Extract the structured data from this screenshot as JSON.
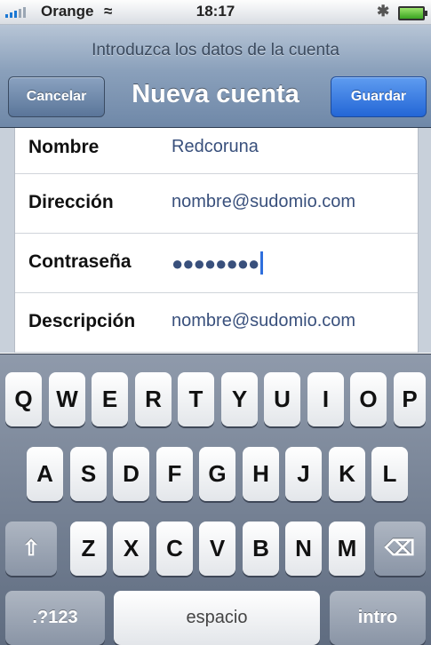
{
  "status_bar": {
    "carrier": "Orange",
    "time": "18:17",
    "wifi_icon": "≈",
    "bluetooth_icon": "✱"
  },
  "nav": {
    "prompt": "Introduzca los datos de la cuenta",
    "title": "Nueva cuenta",
    "cancel_label": "Cancelar",
    "save_label": "Guardar"
  },
  "form": {
    "rows": [
      {
        "label": "Nombre",
        "value": "Redcoruna"
      },
      {
        "label": "Dirección",
        "value": "nombre@sudomio.com"
      },
      {
        "label": "Contraseña",
        "value": "●●●●●●●●"
      },
      {
        "label": "Descripción",
        "value": "nombre@sudomio.com"
      }
    ]
  },
  "keyboard": {
    "row1": [
      "Q",
      "W",
      "E",
      "R",
      "T",
      "Y",
      "U",
      "I",
      "O",
      "P"
    ],
    "row2": [
      "A",
      "S",
      "D",
      "F",
      "G",
      "H",
      "J",
      "K",
      "L"
    ],
    "row3": [
      "Z",
      "X",
      "C",
      "V",
      "B",
      "N",
      "M"
    ],
    "shift_icon": "⇧",
    "delete_icon": "⌫",
    "numbers_label": ".?123",
    "space_label": "espacio",
    "return_label": "intro"
  },
  "colors": {
    "accent_blue": "#2366d6",
    "nav_bar": "#6f88a8",
    "field_text": "#39507c"
  }
}
